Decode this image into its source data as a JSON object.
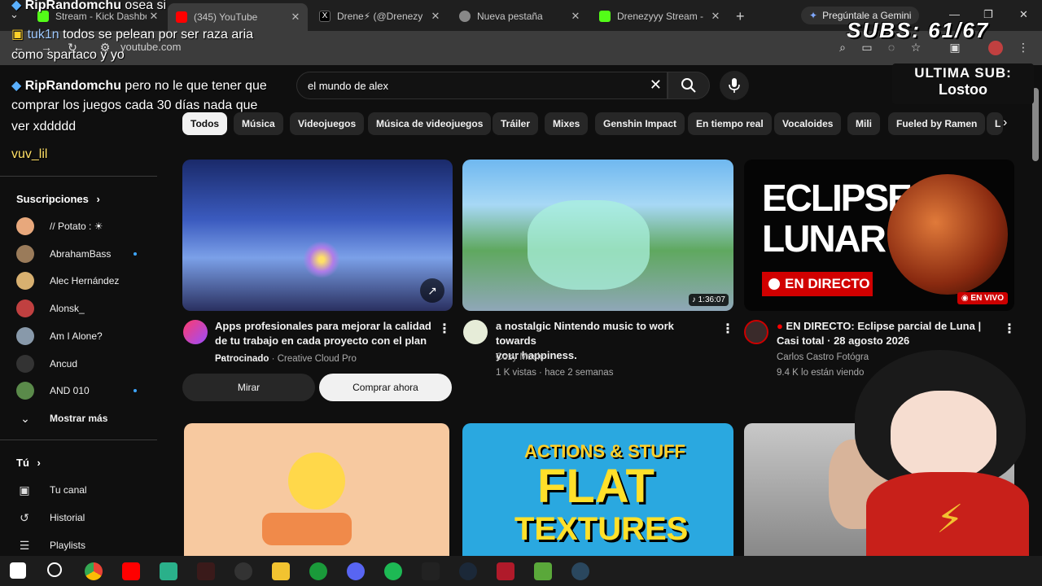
{
  "browser": {
    "tabs": [
      {
        "title": "Stream - Kick Dashbo",
        "icon": "kick-icon"
      },
      {
        "title": "(345) YouTube",
        "icon": "youtube-icon",
        "active": true
      },
      {
        "title": "Drene⚡ (@Drenezy",
        "icon": "x-icon"
      },
      {
        "title": "Nueva pestaña",
        "icon": "chrome-icon"
      },
      {
        "title": "Drenezyyy Stream - ",
        "icon": "kick-icon"
      }
    ],
    "gemini_label": "Pregúntale a Gemini",
    "url": "youtube.com"
  },
  "youtube": {
    "search_query": "el mundo de alex",
    "chips": [
      "Todos",
      "Música",
      "Videojuegos",
      "Música de videojuegos",
      "Tráiler",
      "Mixes",
      "Genshin Impact",
      "En tiempo real",
      "Vocaloides",
      "Mili",
      "Fueled by Ramen",
      "L"
    ],
    "sidebar": {
      "subscriptions_title": "Suscripciones",
      "subscriptions": [
        {
          "name": "// Potato : ☀",
          "dot": false
        },
        {
          "name": "AbrahamBass",
          "dot": true
        },
        {
          "name": "Alec Hernández",
          "dot": false
        },
        {
          "name": "Alonsk_",
          "dot": false
        },
        {
          "name": "Am I Alone?",
          "dot": false
        },
        {
          "name": "Ancud",
          "dot": false
        },
        {
          "name": "AND 010",
          "dot": true
        }
      ],
      "show_more": "Mostrar más",
      "you_title": "Tú",
      "you_items": [
        {
          "label": "Tu canal",
          "icon": "channel-icon"
        },
        {
          "label": "Historial",
          "icon": "history-icon"
        },
        {
          "label": "Playlists",
          "icon": "playlists-icon"
        }
      ]
    },
    "videos": [
      {
        "title_line1": "Apps profesionales para mejorar la calidad",
        "title_line2": "de tu trabajo en cada proyecto con el plan ...",
        "sponsored": "Patrocinado",
        "channel": "· Creative Cloud Pro",
        "btn_watch": "Mirar",
        "btn_buy": "Comprar ahora"
      },
      {
        "title_line1": "a nostalgic Nintendo music to work towards",
        "title_line2": "your happiness.",
        "channel": "Cozy Music",
        "stats": "1 K vistas · hace 2 semanas",
        "duration": "1:36:07"
      },
      {
        "title_line1": "EN DIRECTO: Eclipse parcial de Luna |",
        "title_line2": "Casi total · 28 agosto 2026",
        "channel": "Carlos Castro Fotógra",
        "stats": "9.4 K lo están viendo",
        "live_badge": "EN VIVO",
        "thumb_line1": "ECLIPSE",
        "thumb_line2": "LUNAR",
        "thumb_banner": "EN DIRECTO"
      }
    ],
    "row2_thumbs": {
      "actions_label": "ACTIONS & STUFF",
      "flat_label": "FLAT",
      "textures_label": "TEXTURES"
    }
  },
  "overlay": {
    "chat": [
      {
        "user": "RipRandomchu",
        "text": " osea si",
        "user_color": "#ffffff"
      },
      {
        "user": "tuk1n",
        "text": " todos se pelean por ser raza aria",
        "user_color": "#9fc9ff"
      },
      {
        "user": "",
        "text": "como spartaco y yo",
        "user_color": "#ffffff"
      },
      {
        "user": "RipRandomchu",
        "text": " pero no le que tener que",
        "user_color": "#ffffff"
      },
      {
        "user": "",
        "text": "comprar los juegos cada 30 días nada que",
        "user_color": "#ffffff"
      },
      {
        "user": "",
        "text": "ver xddddd",
        "user_color": "#ffffff"
      },
      {
        "user": "vuv_lil",
        "text": "",
        "user_color": "#ffe066"
      }
    ],
    "subs_counter": "SUBS: 61/67",
    "last_sub_label": "ULTIMA SUB:",
    "last_sub_name": "Lostoo"
  },
  "colors": {
    "yt_bg": "#0f0f0f",
    "chip_bg": "#272727",
    "live_red": "#cc0000",
    "link_blue": "#3ea6ff"
  }
}
